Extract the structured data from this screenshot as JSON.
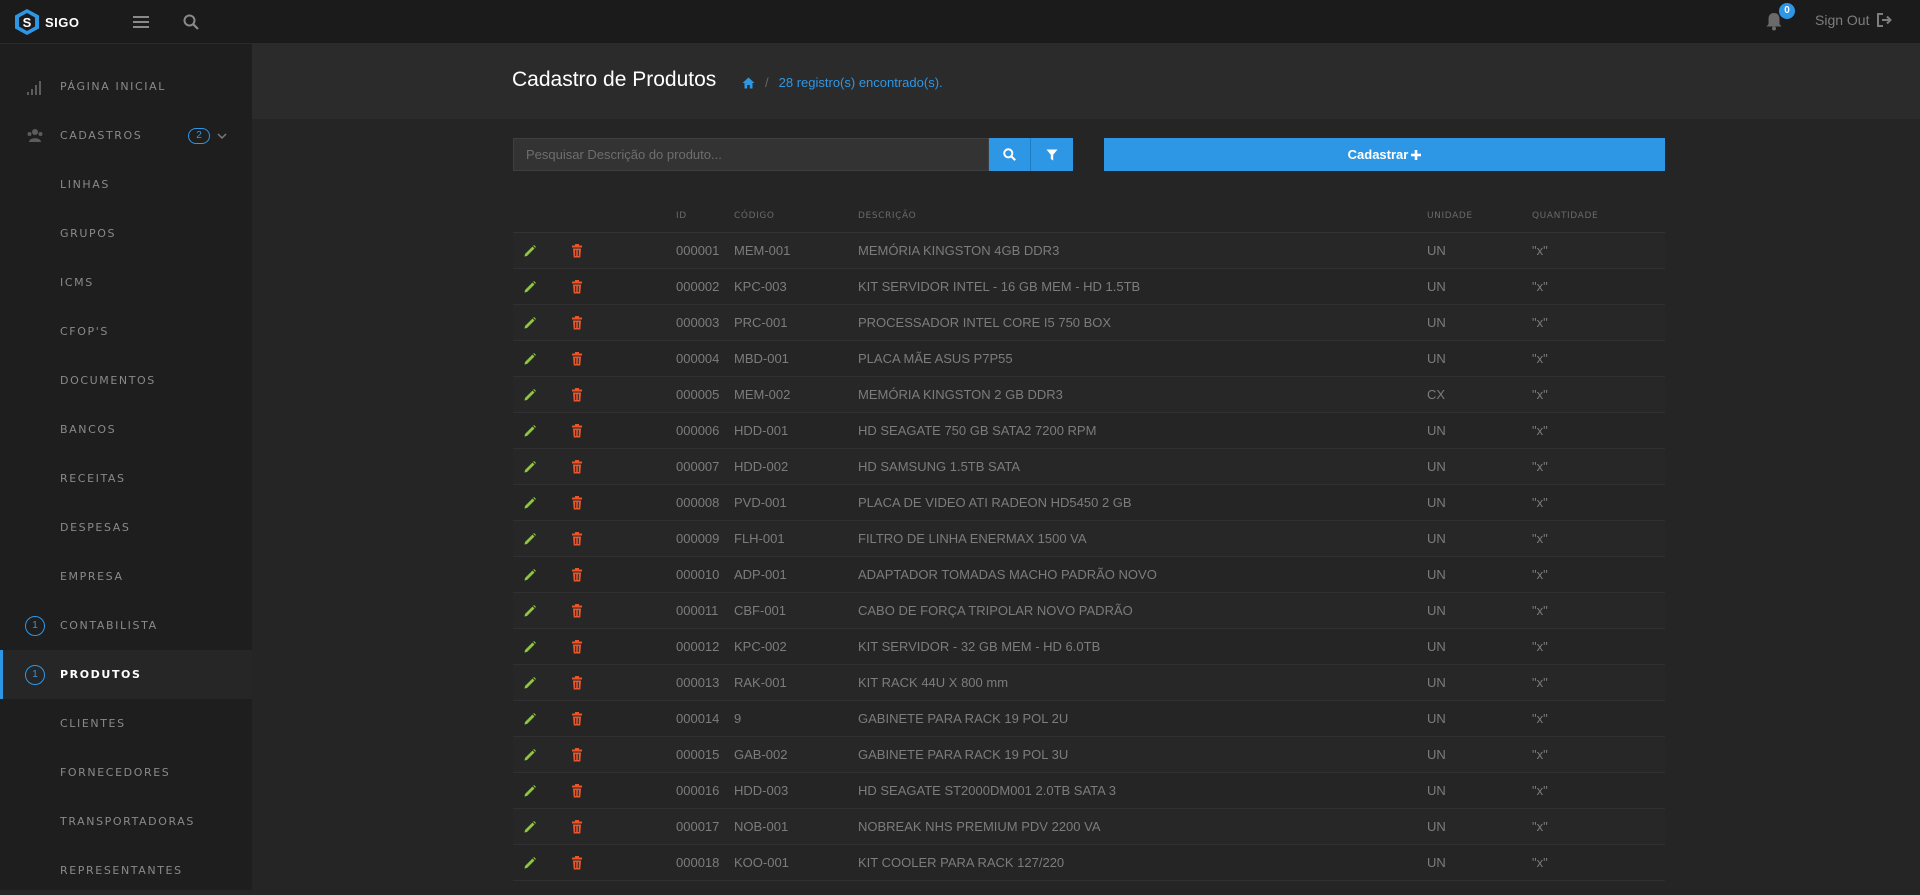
{
  "app": {
    "logo_text": "SIGO"
  },
  "topbar": {
    "notification_count": "0",
    "signout_label": "Sign Out"
  },
  "sidebar": {
    "items": [
      {
        "label": "PÁGINA INICIAL",
        "icon": "signal-icon"
      },
      {
        "label": "CADASTROS",
        "icon": "users-icon",
        "count": "2"
      },
      {
        "label": "LINHAS"
      },
      {
        "label": "GRUPOS"
      },
      {
        "label": "ICMS"
      },
      {
        "label": "CFOP'S"
      },
      {
        "label": "DOCUMENTOS"
      },
      {
        "label": "BANCOS"
      },
      {
        "label": "RECEITAS"
      },
      {
        "label": "DESPESAS"
      },
      {
        "label": "EMPRESA"
      },
      {
        "label": "CONTABILISTA",
        "badge": "1"
      },
      {
        "label": "PRODUTOS",
        "badge": "1",
        "active": true
      },
      {
        "label": "CLIENTES"
      },
      {
        "label": "FORNECEDORES"
      },
      {
        "label": "TRANSPORTADORAS"
      },
      {
        "label": "REPRESENTANTES"
      }
    ]
  },
  "header": {
    "title": "Cadastro de Produtos",
    "breadcrumb_text": "28 registro(s) encontrado(s)."
  },
  "search": {
    "placeholder": "Pesquisar Descrição do produto..."
  },
  "register_button": {
    "label": "Cadastrar"
  },
  "table": {
    "columns": [
      "ID",
      "CÓDIGO",
      "DESCRIÇÃO",
      "UNIDADE",
      "QUANTIDADE"
    ],
    "rows": [
      [
        "000001",
        "MEM-001",
        "MEMÓRIA KINGSTON 4GB DDR3",
        "UN",
        "\"x\""
      ],
      [
        "000002",
        "KPC-003",
        "KIT SERVIDOR INTEL - 16 GB MEM - HD 1.5TB",
        "UN",
        "\"x\""
      ],
      [
        "000003",
        "PRC-001",
        "PROCESSADOR INTEL CORE I5 750 BOX",
        "UN",
        "\"x\""
      ],
      [
        "000004",
        "MBD-001",
        "PLACA MÃE ASUS P7P55",
        "UN",
        "\"x\""
      ],
      [
        "000005",
        "MEM-002",
        "MEMÓRIA KINGSTON 2 GB DDR3",
        "CX",
        "\"x\""
      ],
      [
        "000006",
        "HDD-001",
        "HD SEAGATE 750 GB SATA2 7200 RPM",
        "UN",
        "\"x\""
      ],
      [
        "000007",
        "HDD-002",
        "HD SAMSUNG 1.5TB SATA",
        "UN",
        "\"x\""
      ],
      [
        "000008",
        "PVD-001",
        "PLACA DE VIDEO ATI RADEON HD5450 2 GB",
        "UN",
        "\"x\""
      ],
      [
        "000009",
        "FLH-001",
        "FILTRO DE LINHA ENERMAX 1500 VA",
        "UN",
        "\"x\""
      ],
      [
        "000010",
        "ADP-001",
        "ADAPTADOR TOMADAS MACHO PADRÃO NOVO",
        "UN",
        "\"x\""
      ],
      [
        "000011",
        "CBF-001",
        "CABO DE FORÇA TRIPOLAR NOVO PADRÃO",
        "UN",
        "\"x\""
      ],
      [
        "000012",
        "KPC-002",
        "KIT SERVIDOR - 32 GB MEM - HD 6.0TB",
        "UN",
        "\"x\""
      ],
      [
        "000013",
        "RAK-001",
        "KIT RACK 44U X 800 mm",
        "UN",
        "\"x\""
      ],
      [
        "000014",
        "9",
        "GABINETE PARA RACK 19 POL 2U",
        "UN",
        "\"x\""
      ],
      [
        "000015",
        "GAB-002",
        "GABINETE PARA RACK 19 POL 3U",
        "UN",
        "\"x\""
      ],
      [
        "000016",
        "HDD-003",
        "HD SEAGATE ST2000DM001 2.0TB SATA 3",
        "UN",
        "\"x\""
      ],
      [
        "000017",
        "NOB-001",
        "NOBREAK NHS PREMIUM PDV 2200 VA",
        "UN",
        "\"x\""
      ],
      [
        "000018",
        "KOO-001",
        "KIT COOLER PARA RACK 127/220",
        "UN",
        "\"x\""
      ]
    ]
  },
  "colors": {
    "accent": "#2d97e6",
    "edit": "#8dc63f",
    "delete": "#e8562a"
  }
}
